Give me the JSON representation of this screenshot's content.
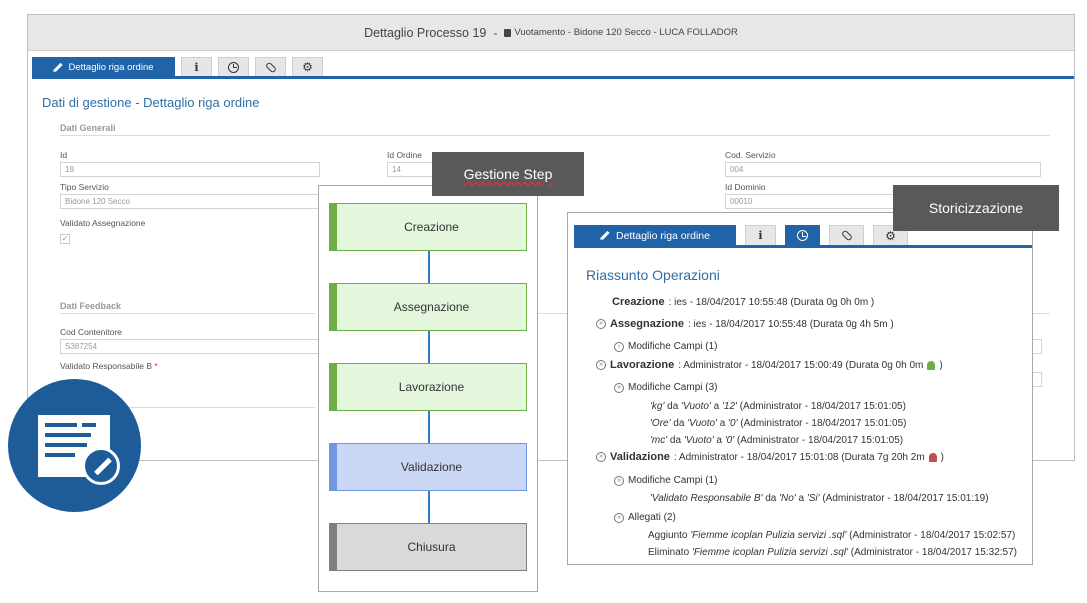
{
  "main_window": {
    "title": "Dettaglio Processo 19",
    "subtitle_separator": "-",
    "subtitle": "Vuotamento - Bidone 120 Secco - LUCA FOLLADOR",
    "tabs": {
      "active_label": "Dettaglio riga ordine",
      "icons": [
        "info-icon",
        "clock-icon",
        "paperclip-icon",
        "gear-icon"
      ]
    },
    "heading": "Dati di gestione - Dettaglio riga ordine",
    "general_section": {
      "title": "Dati Generali",
      "fields": {
        "id": {
          "label": "Id",
          "value": "19"
        },
        "id_ordine": {
          "label": "Id Ordine",
          "value": "14"
        },
        "cod_servizio": {
          "label": "Cod. Servizio",
          "value": "004"
        },
        "tipo_servizio": {
          "label": "Tipo Servizio",
          "value": "Bidone 120 Secco"
        },
        "id_dominio": {
          "label": "Id Dominio",
          "value": "00010"
        },
        "validato_assegnazione": {
          "label": "Validato Assegnazione",
          "checked": true
        }
      }
    },
    "feedback_section": {
      "title": "Dati Feedback",
      "fields": {
        "cod_contenitore": {
          "label": "Cod Contenitore",
          "value": "S387254"
        },
        "validato_resp_b": {
          "label": "Validato Responsabile B",
          "required_mark": "*"
        }
      }
    }
  },
  "steps_panel": {
    "label": "Gestione Step",
    "steps": [
      {
        "label": "Creazione",
        "state": "completed",
        "color": "#70ad47"
      },
      {
        "label": "Assegnazione",
        "state": "completed",
        "color": "#70ad47"
      },
      {
        "label": "Lavorazione",
        "state": "completed",
        "color": "#70ad47"
      },
      {
        "label": "Validazione",
        "state": "current",
        "color": "#6f98e0"
      },
      {
        "label": "Chiusura",
        "state": "pending",
        "color": "#7f7f7f"
      }
    ]
  },
  "history_panel": {
    "label": "Storicizzazione",
    "tabs": {
      "active_label": "Dettaglio riga ordine",
      "icons": [
        "info-icon",
        "clock-icon",
        "paperclip-icon",
        "gear-icon"
      ],
      "selected_icon": "clock-icon"
    },
    "heading": "Riassunto Operazioni",
    "entries": {
      "creazione": {
        "name": "Creazione",
        "detail": ": ies - 18/04/2017 10:55:48 (Durata 0g 0h 0m )"
      },
      "assegnazione": {
        "name": "Assegnazione",
        "detail": ": ies - 18/04/2017 10:55:48 (Durata 0g 4h 5m )",
        "changes": "Modifiche Campi (1)"
      },
      "lavorazione": {
        "name": "Lavorazione",
        "detail": ": Administrator - 18/04/2017 15:00:49 (Durata 0g 0h 0m",
        "bell_color": "#70ad47",
        "changes": "Modifiche Campi (3)",
        "items": [
          {
            "field": "'kg'",
            "mid1": " da ",
            "from": "'Vuoto'",
            "mid2": " a ",
            "to": "'12'",
            "tail": " (Administrator - 18/04/2017 15:01:05)"
          },
          {
            "field": "'Ore'",
            "mid1": " da ",
            "from": "'Vuoto'",
            "mid2": " a ",
            "to": "'0'",
            "tail": " (Administrator - 18/04/2017 15:01:05)"
          },
          {
            "field": "'mc'",
            "mid1": " da ",
            "from": "'Vuoto'",
            "mid2": " a ",
            "to": "'0'",
            "tail": " (Administrator - 18/04/2017 15:01:05)"
          }
        ]
      },
      "validazione": {
        "name": "Validazione",
        "detail": ": Administrator - 18/04/2017 15:01:08 (Durata 7g 20h 2m",
        "bell_color": "#c0504d",
        "changes": "Modifiche Campi (1)",
        "change_item": {
          "field": "'Validato Responsabile B'",
          "mid1": " da ",
          "from": "'No'",
          "mid2": " a ",
          "to": "'Si'",
          "tail": " (Administrator - 18/04/2017 15:01:19)"
        },
        "attachments": "Allegati (2)",
        "attachment_items": [
          {
            "action": "Aggiunto ",
            "file": "'Fiemme icoplan Pulizia servizi .sql'",
            "tail": " (Administrator - 18/04/2017 15:02:57)"
          },
          {
            "action": "Eliminato ",
            "file": "'Fiemme icoplan Pulizia servizi .sql'",
            "tail": " (Administrator - 18/04/2017 15:32:57)"
          }
        ]
      }
    }
  },
  "colors": {
    "accent": "#2163a8",
    "heading": "#2f6ea8",
    "badge_circle": "#1d5c99"
  }
}
